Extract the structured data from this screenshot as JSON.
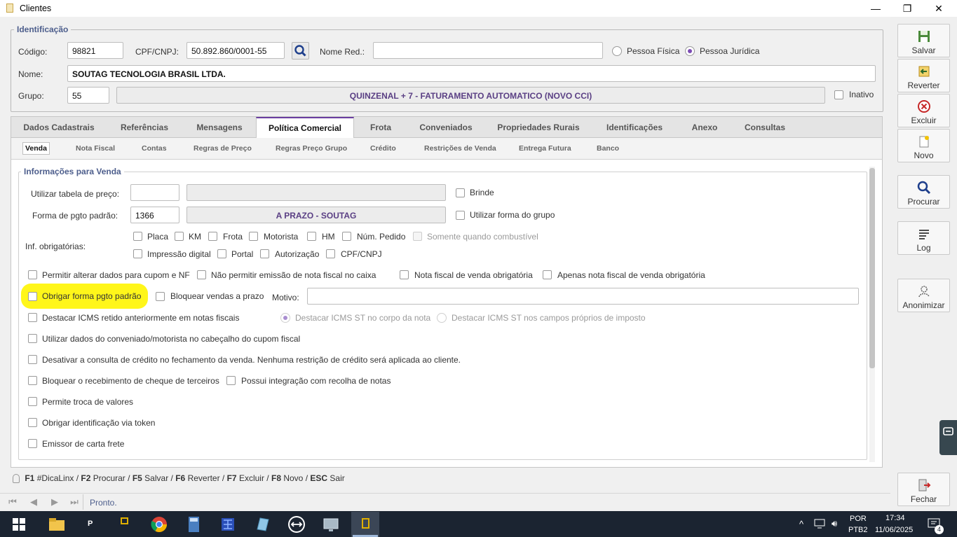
{
  "window": {
    "title": "Clientes",
    "minimize": "—",
    "restore": "❐",
    "close": "✕"
  },
  "identificacao": {
    "legend": "Identificação",
    "codigo_label": "Código:",
    "codigo": "98821",
    "cpf_label": "CPF/CNPJ:",
    "cpf": "50.892.860/0001-55",
    "nome_red_label": "Nome Red.:",
    "nome_red": "",
    "pessoa_fisica": "Pessoa Física",
    "pessoa_juridica": "Pessoa Jurídica",
    "nome_label": "Nome:",
    "nome": "SOUTAG TECNOLOGIA BRASIL LTDA.",
    "grupo_label": "Grupo:",
    "grupo": "55",
    "grupo_desc": "QUINZENAL + 7 - FATURAMENTO AUTOMATICO (NOVO CCI)",
    "inativo": "Inativo"
  },
  "tabs": [
    "Dados Cadastrais",
    "Referências",
    "Mensagens",
    "Política Comercial",
    "Frota",
    "Conveniados",
    "Propriedades Rurais",
    "Identificações",
    "Anexo",
    "Consultas"
  ],
  "subtabs": [
    "Venda",
    "Nota Fiscal",
    "Contas",
    "Regras de Preço",
    "Regras Preço Grupo",
    "Crédito",
    "Restrições de Venda",
    "Entrega Futura",
    "Banco"
  ],
  "venda": {
    "legend": "Informações para Venda",
    "tabela_label": "Utilizar tabela de preço:",
    "tabela_code": "",
    "tabela_desc": "",
    "brinde": "Brinde",
    "forma_label": "Forma de pgto padrão:",
    "forma_code": "1366",
    "forma_desc": "A PRAZO - SOUTAG",
    "utilizar_forma_grupo": "Utilizar forma do grupo",
    "inf_label": "Inf. obrigatórias:",
    "inf_row1": [
      "Placa",
      "KM",
      "Frota",
      "Motorista",
      "HM",
      "Núm. Pedido",
      "Somente quando combustível"
    ],
    "inf_row2": [
      "Impressão digital",
      "Portal",
      "Autorização",
      "CPF/CNPJ"
    ],
    "opt_permitir_alterar": "Permitir alterar dados para cupom e NF",
    "opt_nao_permitir": "Não permitir emissão de nota fiscal no caixa",
    "opt_nf_obrigatoria": "Nota fiscal de venda obrigatória",
    "opt_apenas_nf": "Apenas nota fiscal de venda obrigatória",
    "opt_obrigar_forma": "Obrigar forma pgto padrão",
    "opt_bloquear_prazo": "Bloquear vendas a prazo",
    "motivo_label": "Motivo:",
    "motivo": "",
    "opt_destacar_icms": "Destacar ICMS retido anteriormente em notas fiscais",
    "radio_corpo": "Destacar ICMS  ST no corpo da nota",
    "radio_campos": "Destacar ICMS ST nos campos próprios de imposto",
    "opt_utilizar_dados": "Utilizar dados do conveniado/motorista no cabeçalho do cupom fiscal",
    "opt_desativar_credito": "Desativar a consulta de crédito no fechamento da venda. Nenhuma restrição de crédito será aplicada ao cliente.",
    "opt_bloquear_cheque": "Bloquear o recebimento de cheque de terceiros",
    "opt_integracao": "Possui integração com recolha de notas",
    "opt_troca": "Permite troca de valores",
    "opt_token": "Obrigar identificação via token",
    "opt_carta_frete": "Emissor de carta frete"
  },
  "side": {
    "salvar": "Salvar",
    "reverter": "Reverter",
    "excluir": "Excluir",
    "novo": "Novo",
    "procurar": "Procurar",
    "log": "Log",
    "anonimizar": "Anonimizar",
    "fechar": "Fechar"
  },
  "shortcuts": {
    "f1": "F1",
    "f1_t": "#DicaLinx /",
    "f2": "F2",
    "f2_t": "Procurar /",
    "f5": "F5",
    "f5_t": "Salvar /",
    "f6": "F6",
    "f6_t": "Reverter /",
    "f7": "F7",
    "f7_t": "Excluir /",
    "f8": "F8",
    "f8_t": "Novo /",
    "esc": "ESC",
    "esc_t": "Sair"
  },
  "status": "Pronto.",
  "tray": {
    "lang1": "POR",
    "lang2": "PTB2",
    "time": "17:34",
    "date": "11/06/2025",
    "notif": "4",
    "p": "P"
  },
  "colors": {
    "accent": "#6a3ea0",
    "highlight": "#fff61a",
    "taskbar": "#1b2431"
  }
}
